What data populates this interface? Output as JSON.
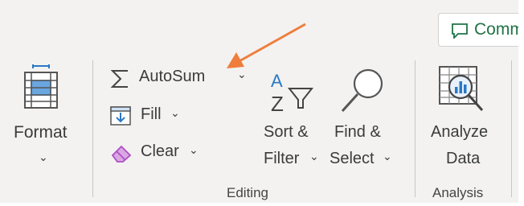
{
  "ribbon": {
    "format": {
      "label": "Format"
    },
    "editing": {
      "autosum_label": "AutoSum",
      "fill_label": "Fill",
      "clear_label": "Clear",
      "sort_filter_line1": "Sort &",
      "sort_filter_line2": "Filter",
      "find_select_line1": "Find &",
      "find_select_line2": "Select",
      "group_label": "Editing"
    },
    "analysis": {
      "analyze_line1": "Analyze",
      "analyze_line2": "Data",
      "group_label": "Analysis"
    },
    "comments": {
      "label": "Comm"
    }
  },
  "colors": {
    "ribbon_bg": "#f3f2f1",
    "excel_green": "#217346",
    "annotation_arrow": "#ef7d3c",
    "icon_blue": "#2b78c6",
    "eraser_purple": "#b04ec4"
  },
  "icons": [
    "format-cells-icon",
    "autosum-sigma-icon",
    "fill-down-icon",
    "eraser-icon",
    "sort-filter-icon",
    "magnifier-icon",
    "analyze-data-icon",
    "comment-icon"
  ]
}
